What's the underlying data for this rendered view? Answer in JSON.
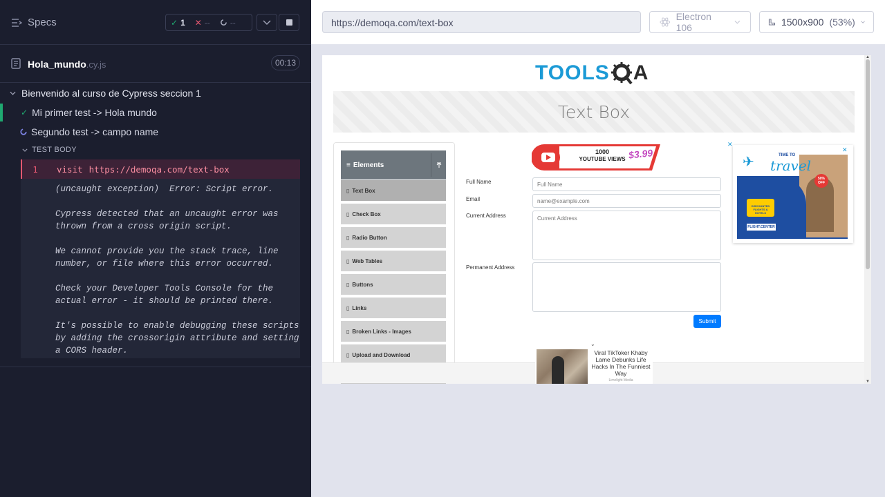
{
  "runner": {
    "specs_label": "Specs",
    "passed_count": "1",
    "failed_count": "--",
    "pending_count": "--",
    "spec_name": "Hola_mundo",
    "spec_ext": ".cy.js",
    "duration": "00:13",
    "suite_title": "Bienvenido al curso de Cypress seccion 1",
    "tests": [
      {
        "title": "Mi primer test -> Hola mundo",
        "state": "passed"
      },
      {
        "title": "Segundo test -> campo name",
        "state": "running"
      }
    ],
    "test_body_label": "TEST BODY",
    "command": {
      "number": "1",
      "name": "visit",
      "arg": "https://demoqa.com/text-box"
    },
    "error": {
      "heading": "(uncaught exception)  Error: Script error.",
      "para1": "Cypress detected that an uncaught error was\nthrown from a cross origin script.",
      "para2": "We cannot provide you the stack trace, line\nnumber, or file where this error occurred.",
      "para3": "Check your Developer Tools Console for the\nactual error - it should be printed there.",
      "para4": "It's possible to enable debugging these scripts\nby adding the crossorigin attribute and setting\na CORS header."
    }
  },
  "browser": {
    "url": "https://demoqa.com/text-box",
    "browser_name": "Electron 106",
    "viewport": "1500x900",
    "scale": "(53%)"
  },
  "aut": {
    "logo_left": "TOOLS",
    "logo_right": "A",
    "page_title": "Text Box",
    "sidebar_header": "Elements",
    "sidebar_items": [
      "Text Box",
      "Check Box",
      "Radio Button",
      "Web Tables",
      "Buttons",
      "Links",
      "Broken Links - Images",
      "Upload and Download"
    ],
    "yt_ad": {
      "line1": "1000",
      "line2": "YOUTUBE VIEWS",
      "price": "$3.99"
    },
    "form": {
      "full_name_label": "Full Name",
      "full_name_placeholder": "Full Name",
      "email_label": "Email",
      "email_placeholder": "name@example.com",
      "current_address_label": "Current Address",
      "current_address_placeholder": "Current Address",
      "permanent_address_label": "Permanent Address",
      "submit_label": "Submit"
    },
    "travel_ad": {
      "line1": "TIME TO",
      "line2": "travel",
      "badge": "50% OFF",
      "box": "DISCOUNTED FLIGHTS & HOTELS",
      "brand": "FLIGHT.CENTER"
    },
    "tiktok": {
      "text": "Viral TikToker Khaby Lame Debunks Life Hacks In The Funniest Way",
      "source": "Limelight Media"
    }
  },
  "colors": {
    "pass": "#1fa971",
    "fail": "#e45770",
    "accent": "#1b9ad6",
    "submit": "#007bff"
  }
}
